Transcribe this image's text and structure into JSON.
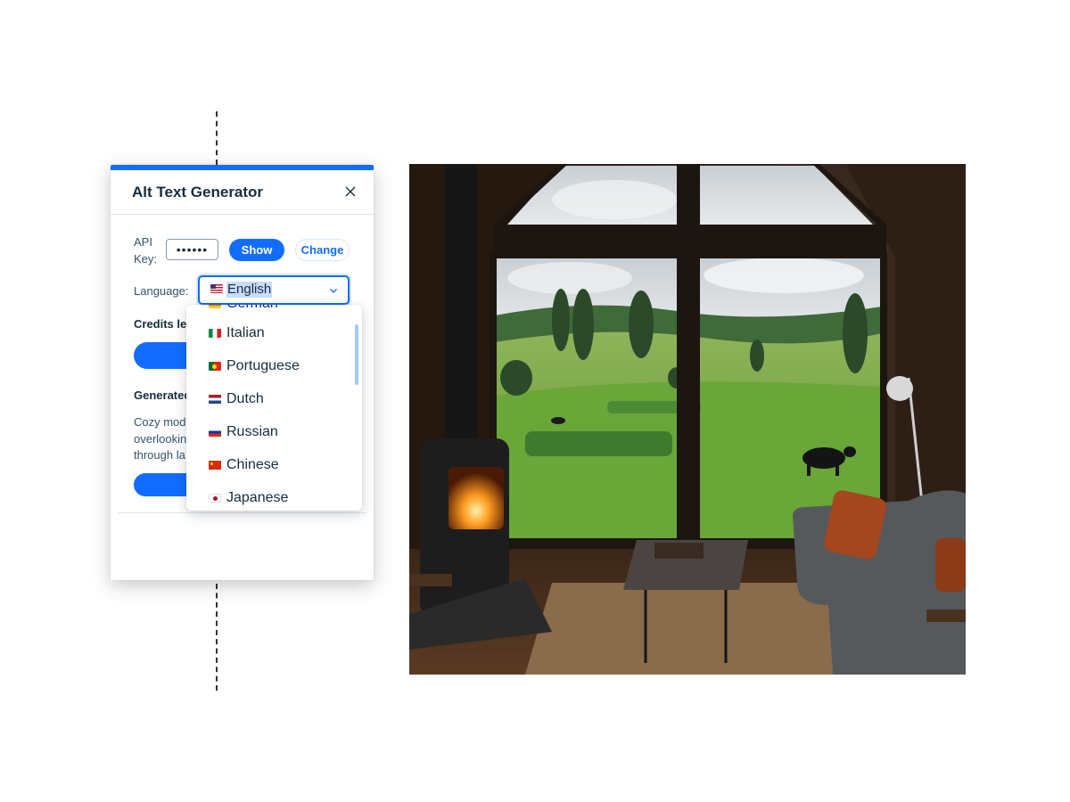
{
  "panel": {
    "title": "Alt Text Generator",
    "accent_color": "#116dff",
    "close_icon": "close-icon",
    "api_key": {
      "label": "API Key:",
      "masked_value": "••••••",
      "show_label": "Show",
      "change_label": "Change"
    },
    "language": {
      "label": "Language:",
      "selected": "English",
      "selected_flag": "flag-us-icon"
    },
    "credits_label": "Credits lef",
    "generated_label": "Generated",
    "generated_lines": [
      "Cozy mode",
      "overlookin",
      "through la"
    ]
  },
  "dropdown": {
    "partial_item": "German",
    "options": [
      {
        "label": "Italian",
        "flag": "flag-italy-icon"
      },
      {
        "label": "Portuguese",
        "flag": "flag-portugal-icon"
      },
      {
        "label": "Dutch",
        "flag": "flag-netherlands-icon"
      },
      {
        "label": "Russian",
        "flag": "flag-russia-icon"
      },
      {
        "label": "Chinese",
        "flag": "flag-china-icon"
      },
      {
        "label": "Japanese",
        "flag": "flag-japan-icon"
      }
    ]
  },
  "photo": {
    "subject": "cabin-living-room-with-pasture-view-image"
  }
}
